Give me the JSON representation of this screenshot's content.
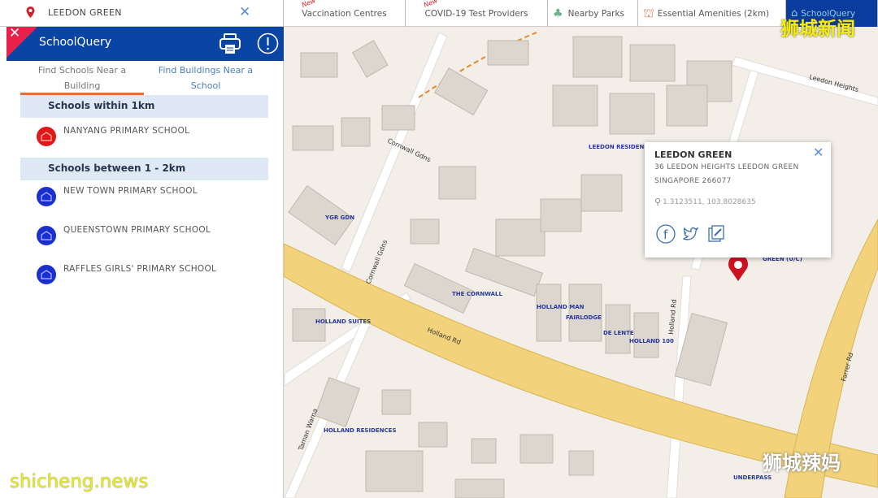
{
  "search": {
    "value": "LEEDON GREEN",
    "clear_icon": "close-icon",
    "pin_icon": "location-pin-icon"
  },
  "top_tabs": [
    {
      "label": "Vaccination Centres",
      "badge": "New"
    },
    {
      "label": "COVID-19 Test Providers",
      "badge": "New"
    },
    {
      "label": "Nearby Parks",
      "icon": "tree-icon"
    },
    {
      "label": "Essential Amenities (2km)",
      "icon": "amenities-icon"
    },
    {
      "label": "SchoolQuery",
      "icon": "school-icon",
      "active": true
    }
  ],
  "panel": {
    "title": "SchoolQuery",
    "tabs": [
      {
        "label": "Find Schools Near a Building",
        "active": true
      },
      {
        "label": "Find Buildings Near a School"
      }
    ],
    "sections": [
      {
        "heading": "Schools within 1km",
        "schools": [
          {
            "name": "NANYANG PRIMARY SCHOOL",
            "color": "#e01818"
          }
        ]
      },
      {
        "heading": "Schools between 1 - 2km",
        "schools": [
          {
            "name": "NEW TOWN PRIMARY SCHOOL",
            "color": "#1a2fd0"
          },
          {
            "name": "QUEENSTOWN PRIMARY SCHOOL",
            "color": "#1a2fd0"
          },
          {
            "name": "RAFFLES GIRLS' PRIMARY SCHOOL",
            "color": "#1a2fd0"
          }
        ]
      }
    ]
  },
  "popup": {
    "title": "LEEDON GREEN",
    "address1": "36 LEEDON HEIGHTS LEEDON GREEN",
    "address2": "SINGAPORE 266077",
    "coords": "1.3123511, 103.8028635"
  },
  "map": {
    "labels": {
      "holland_rd": "Holland Rd",
      "holland_rd2": "Holland Rd",
      "farrer_rd": "Farrer Rd",
      "leedon_heights": "Leedon Heights",
      "cornwall": "Cornwall Gdns",
      "cornwall2": "Cornwall Gdns",
      "leedon_res": "LEEDON RESIDENCE",
      "the_cornwall": "THE CORNWALL",
      "holland_man": "HOLLAND MAN",
      "fairlodge": "FAIRLODGE",
      "de_lente": "DE LENTE",
      "holland100": "HOLLAND 100",
      "holland_suites": "HOLLAND SUITES",
      "holland_res": "HOLLAND RESIDENCES",
      "taman_warna": "Taman Warna",
      "green_uc": "GREEN (U/C)",
      "underpass": "UNDERPASS",
      "ygr": "YGR GDN"
    }
  },
  "watermarks": {
    "top": "狮城新闻",
    "bottom_left": "shicheng.news",
    "bottom_right": "狮城辣妈"
  },
  "colors": {
    "header": "#0a44a4",
    "close": "#e8204a",
    "tab_underline": "#e07040",
    "section_bg": "#dfe8f5",
    "road": "#f2d27a"
  }
}
